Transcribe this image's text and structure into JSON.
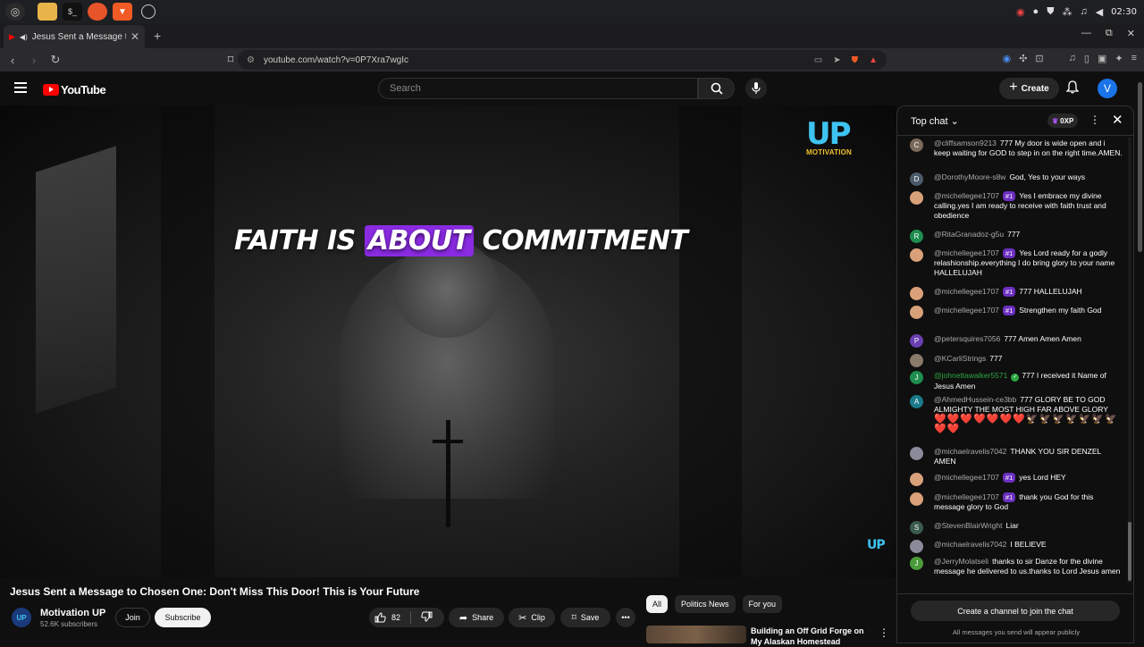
{
  "browser": {
    "tab_title": "Jesus Sent a Message to C",
    "url": "youtube.com/watch?v=0P7Xra7wgIc",
    "clock": "02:30"
  },
  "youtube": {
    "logo_text": "YouTube",
    "search_placeholder": "Search",
    "create_label": "Create",
    "avatar_letter": "V"
  },
  "video": {
    "overlay_before": "FAITH IS ",
    "overlay_highlight": "ABOUT",
    "overlay_after": " COMMITMENT",
    "watermark_logo": "UP",
    "watermark_sub": "MOTIVATION",
    "small_logo": "UP"
  },
  "below": {
    "title": "Jesus Sent a Message to Chosen One: Don't Miss This Door! This is Your Future",
    "channel_avatar": "UP",
    "channel_name": "Motivation UP",
    "subscribers": "52.6K subscribers",
    "join_label": "Join",
    "subscribe_label": "Subscribe",
    "likes": "82",
    "share_label": "Share",
    "clip_label": "Clip",
    "save_label": "Save"
  },
  "chips": [
    "All",
    "Politics News",
    "For you"
  ],
  "recommendation": {
    "title": "Building an Off Grid Forge on My Alaskan Homestead"
  },
  "chat": {
    "mode_label": "Top chat",
    "points_label": "0XP",
    "messages": [
      {
        "avatar": "C",
        "color": "#7a6a5a",
        "author": "@cliffsamson9213",
        "badge": "",
        "text": "777 My door is wide open and i keep waiting for GOD to step in on the right time.AMEN."
      },
      {
        "avatar": "D",
        "color": "#4a5a6a",
        "author": "@DorothyMoore-s8w",
        "badge": "",
        "text": "God, Yes to your ways"
      },
      {
        "avatar": "",
        "color": "#d9a17a",
        "author": "@michellegee1707",
        "badge": "#1",
        "text": "Yes I embrace my divine calling.yes I am ready to receive with faith trust and obedience"
      },
      {
        "avatar": "R",
        "color": "#1e8e4e",
        "author": "@RitaGranadoz-g5u",
        "badge": "",
        "text": "777"
      },
      {
        "avatar": "",
        "color": "#d9a17a",
        "author": "@michellegee1707",
        "badge": "#1",
        "text": "Yes Lord ready for a godly relashionship.everything I do bring glory to your name HALLELUJAH"
      },
      {
        "avatar": "",
        "color": "#d9a17a",
        "author": "@michellegee1707",
        "badge": "#1",
        "text": "777 HALLELUJAH"
      },
      {
        "avatar": "",
        "color": "#d9a17a",
        "author": "@michellegee1707",
        "badge": "#1",
        "text": "Strengthen my faith God"
      },
      {
        "avatar": "P",
        "color": "#6a3fb0",
        "author": "@petersquires7056",
        "badge": "",
        "text": "777 Amen Amen Amen"
      },
      {
        "avatar": "",
        "color": "#8a7a6a",
        "author": "@KCarliStrings",
        "badge": "",
        "text": "777"
      },
      {
        "avatar": "J",
        "color": "#1e8e4e",
        "author": "@johnettawalker5571",
        "badge": "",
        "verified": true,
        "text": "777 I received it Name of Jesus Amen"
      },
      {
        "avatar": "A",
        "color": "#1a7a8a",
        "author": "@AhmedHussein-ce3bb",
        "badge": "",
        "text": "777 GLORY BE TO GOD ALMIGHTY THE MOST HIGH FAR ABOVE GLORY",
        "emoji": "❤️❤️❤️❤️❤️❤️❤️🦅🦅🦅🦅🦅🦅🦅❤️❤️"
      },
      {
        "avatar": "",
        "color": "#8a8a9a",
        "author": "@michaelravelis7042",
        "badge": "",
        "text": "THANK YOU SIR DENZEL AMEN"
      },
      {
        "avatar": "",
        "color": "#d9a17a",
        "author": "@michellegee1707",
        "badge": "#1",
        "text": "yes Lord HEY"
      },
      {
        "avatar": "",
        "color": "#d9a17a",
        "author": "@michellegee1707",
        "badge": "#1",
        "text": "thank you God for this message glory to God"
      },
      {
        "avatar": "S",
        "color": "#3a5a4a",
        "author": "@StevenBlairWright",
        "badge": "",
        "text": "Liar"
      },
      {
        "avatar": "",
        "color": "#8a8a9a",
        "author": "@michaelravelis7042",
        "badge": "",
        "text": "I BELIEVE"
      },
      {
        "avatar": "J",
        "color": "#4a9a3a",
        "author": "@JerryMolatseli",
        "badge": "",
        "text": "thanks to sir Danze for the divine message he delivered to us.thanks to Lord Jesus amen"
      }
    ],
    "create_channel_label": "Create a channel to join the chat",
    "public_note": "All messages you send will appear publicly"
  }
}
